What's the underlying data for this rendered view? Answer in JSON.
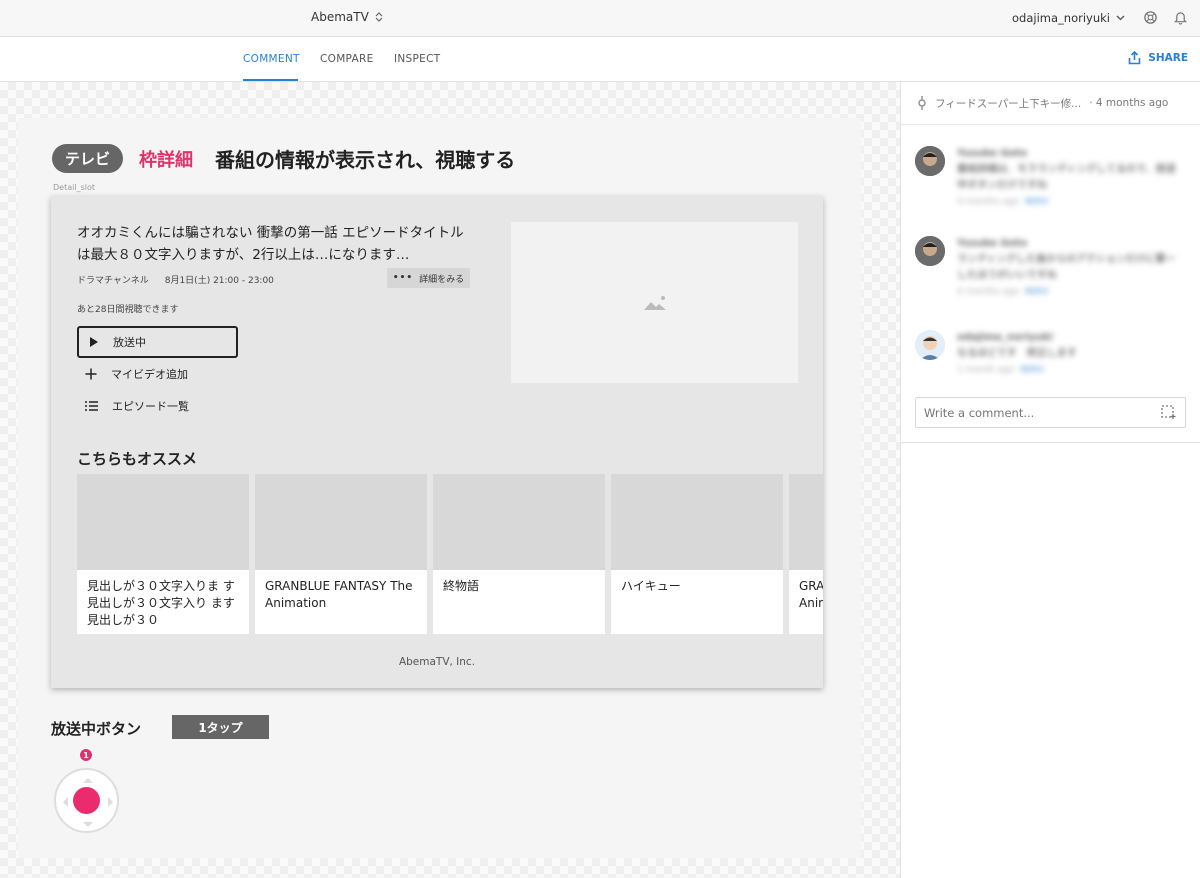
{
  "topbar": {
    "project": "AbemaTV",
    "user": "odajima_noriyuki"
  },
  "tabs": [
    {
      "label": "COMMENT",
      "active": true
    },
    {
      "label": "COMPARE",
      "active": false
    },
    {
      "label": "INSPECT",
      "active": false
    }
  ],
  "share_label": "SHARE",
  "artboard": {
    "pill": "テレビ",
    "heading_pink": "枠詳細",
    "heading_title": "番組の情報が表示され、視聴する",
    "slot_label": "Detail_slot",
    "episode_title": "オオカミくんには騙されない 衝撃の第一話 エピソードタイトルは最大８０文字入りますが、2行以上は…になります…",
    "channel": "ドラマチャンネル",
    "airtime": "8月1日(土) 21:00 - 23:00",
    "detail_button": "詳細をみる",
    "remaining": "あと28日間視聴できます",
    "play_label": "放送中",
    "add_mylist": "マイビデオ追加",
    "episode_list": "エピソード一覧",
    "reco_heading": "こちらもオススメ",
    "reco_items": [
      "見出しが３０文字入りま す見出しが３０文字入り ます見出しが３０",
      "GRANBLUE FANTASY The Animation",
      "終物語",
      "ハイキュー",
      "GRANBLUE FANTASY The Animation"
    ],
    "footer": "AbemaTV, Inc.",
    "onair_label": "放送中ボタン",
    "tap_badge": "1タップ",
    "hotspot_number": "1"
  },
  "panel": {
    "version": "フィードスーパー上下キー修...",
    "version_time": "· 4 months ago",
    "comments": [
      {
        "name": "Yusuke Goto",
        "text": "番組詳細は、モラランディングしてるので、放送中ボタンだけですね",
        "time": "4 months ago",
        "reply": "REPLY"
      },
      {
        "name": "Yusuke Goto",
        "text": "ランディングした後からのアクションだけに繋ーしたほうがいいですね",
        "time": "4 months ago",
        "reply": "REPLY"
      },
      {
        "name": "odajima_noriyuki",
        "text": "なるほどです　修正します",
        "time": "1 month ago",
        "reply": "REPLY"
      }
    ],
    "comment_placeholder": "Write a comment..."
  }
}
